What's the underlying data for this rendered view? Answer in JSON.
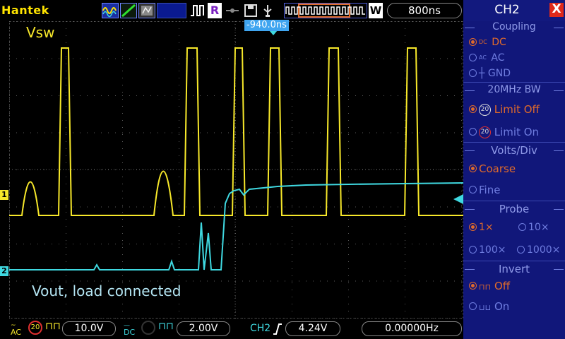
{
  "app": {
    "brand": "Hantek",
    "timebase": "800ns"
  },
  "toolbar": {
    "run_mark": "R",
    "wave_mark": "W"
  },
  "scope": {
    "trigger_position": "-940.0ns",
    "ch1_label": "Vsw",
    "ch2_label": "Vout, load connected",
    "ch1_marker": "1",
    "ch2_marker": "2",
    "ch1_color": "#f7e82a",
    "ch2_color": "#3fd8e0"
  },
  "bottom": {
    "ch1_coupling_icon": "AC",
    "ch1_bw_icon": "20",
    "ch1_volts": "10.0V",
    "ch2_coupling_icon": "DC",
    "ch2_volts": "2.00V",
    "trigger_source": "CH2",
    "trigger_level": "4.24V",
    "frequency": "0.00000Hz"
  },
  "panel": {
    "title": "CH2",
    "close": "X",
    "coupling": {
      "title": "Coupling",
      "dc": "DC",
      "ac": "AC",
      "gnd": "GND",
      "dc_icon": "DC",
      "ac_icon": "AC"
    },
    "bw": {
      "title": "20MHz BW",
      "limit_off": "Limit Off",
      "limit_on": "Limit On",
      "icon": "20"
    },
    "volts": {
      "title": "Volts/Div",
      "coarse": "Coarse",
      "fine": "Fine"
    },
    "probe": {
      "title": "Probe",
      "x1": "1×",
      "x10": "10×",
      "x100": "100×",
      "x1000": "1000×"
    },
    "invert": {
      "title": "Invert",
      "off": "Off",
      "on": "On"
    }
  }
}
